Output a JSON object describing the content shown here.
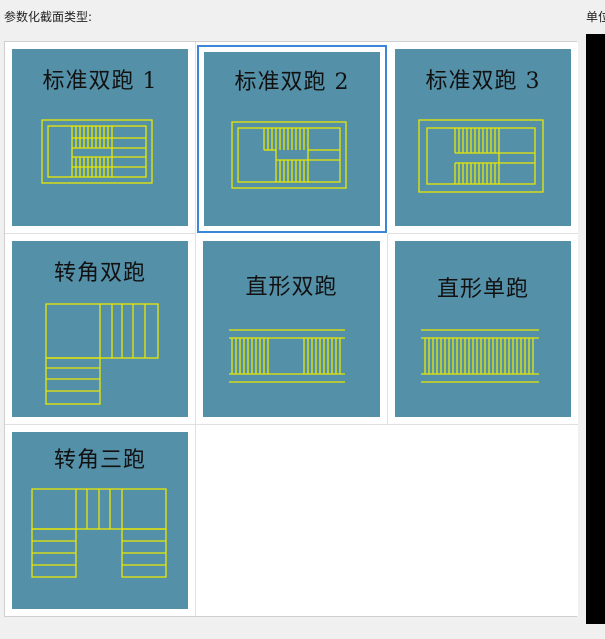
{
  "section_label": "参数化截面类型:",
  "right_label": "单位",
  "tiles": [
    {
      "label": "标准双跑 1"
    },
    {
      "label": "标准双跑 2"
    },
    {
      "label": "标准双跑 3"
    },
    {
      "label": "转角双跑"
    },
    {
      "label": "直形双跑"
    },
    {
      "label": "直形单跑"
    },
    {
      "label": "转角三跑"
    }
  ],
  "selected_index": 1,
  "icon_color": "#e8e800",
  "tile_color": "#5490a8",
  "selection_color": "#3a86d8"
}
